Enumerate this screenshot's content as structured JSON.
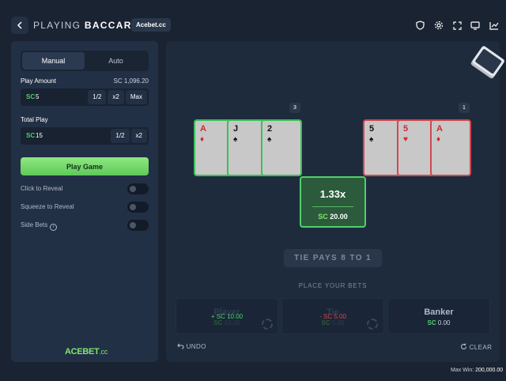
{
  "header": {
    "title_prefix": "PLAYING",
    "title_game": "BACCARAT",
    "site_badge": "Acebet.cc",
    "icons": [
      "shield-icon",
      "gear-icon",
      "expand-icon",
      "monitor-icon",
      "chart-icon"
    ]
  },
  "sidebar": {
    "modes": [
      "Manual",
      "Auto"
    ],
    "active_mode": "Manual",
    "play_amount_label": "Play Amount",
    "balance": "SC 1,096.20",
    "play_amount_currency": "SC",
    "play_amount_value": "5",
    "play_amount_buttons": [
      "1/2",
      "x2",
      "Max"
    ],
    "total_play_label": "Total Play",
    "total_play_currency": "SC",
    "total_play_value": "15",
    "total_play_buttons": [
      "1/2",
      "x2"
    ],
    "play_button": "Play Game",
    "toggles": [
      {
        "label": "Click to Reveal",
        "on": false
      },
      {
        "label": "Squeeze to Reveal",
        "on": false
      },
      {
        "label": "Side Bets",
        "on": false
      }
    ],
    "logo_main": "ACEBET",
    "logo_suffix": ".cc"
  },
  "table": {
    "player_count": "3",
    "banker_count": "1",
    "player_cards": [
      {
        "rank": "A",
        "suit": "♦",
        "color": "red"
      },
      {
        "rank": "J",
        "suit": "♠",
        "color": "black"
      },
      {
        "rank": "2",
        "suit": "♠",
        "color": "black"
      }
    ],
    "banker_cards": [
      {
        "rank": "5",
        "suit": "♠",
        "color": "black"
      },
      {
        "rank": "5",
        "suit": "♥",
        "color": "red"
      },
      {
        "rank": "A",
        "suit": "♦",
        "color": "red"
      }
    ],
    "multiplier": "1.33x",
    "payout_currency": "SC",
    "payout_amount": "20.00",
    "tie_pays": "TIE PAYS 8 TO 1",
    "place_bets": "PLACE YOUR BETS",
    "bets": [
      {
        "name": "Player",
        "currency": "SC",
        "amount": "10.00",
        "result": "+ SC 10.00"
      },
      {
        "name": "Tie",
        "currency": "SC",
        "amount": "5.00",
        "result": "- SC 5.00"
      },
      {
        "name": "Banker",
        "currency": "SC",
        "amount": "0.00",
        "result": ""
      }
    ],
    "undo": "UNDO",
    "clear": "CLEAR"
  },
  "footer": {
    "max_win_label": "Max Win:",
    "max_win_value": "200,000.00"
  },
  "colors": {
    "background": "#1a2332",
    "panel": "#223045",
    "accent_green": "#4fd16a",
    "player_border": "#3bbf55",
    "banker_border": "#d1484e"
  }
}
